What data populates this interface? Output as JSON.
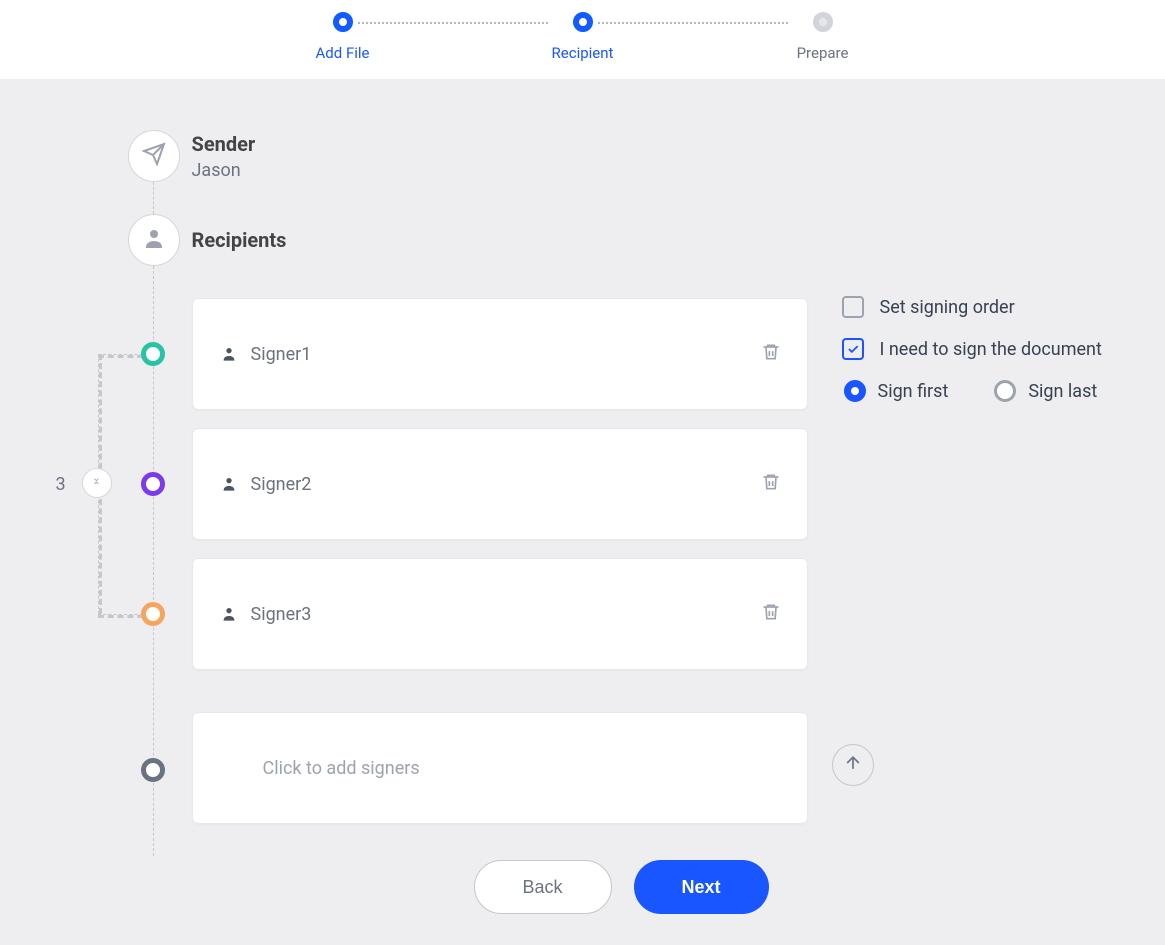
{
  "stepper": {
    "steps": [
      {
        "label": "Add File",
        "state": "active"
      },
      {
        "label": "Recipient",
        "state": "active"
      },
      {
        "label": "Prepare",
        "state": "inactive"
      }
    ]
  },
  "sender": {
    "title": "Sender",
    "name": "Jason"
  },
  "recipients": {
    "title": "Recipients",
    "group_count": "3",
    "signers": [
      {
        "name": "Signer1",
        "node_color": "#28c3a3"
      },
      {
        "name": "Signer2",
        "node_color": "#7c3aed"
      },
      {
        "name": "Signer3",
        "node_color": "#f6a55f"
      }
    ],
    "add_placeholder": "Click to add signers"
  },
  "options": {
    "set_order_label": "Set signing order",
    "set_order_checked": false,
    "need_sign_label": "I need to sign the document",
    "need_sign_checked": true,
    "radio_first_label": "Sign first",
    "radio_last_label": "Sign last",
    "radio_selected": "first"
  },
  "footer": {
    "back_label": "Back",
    "next_label": "Next"
  }
}
